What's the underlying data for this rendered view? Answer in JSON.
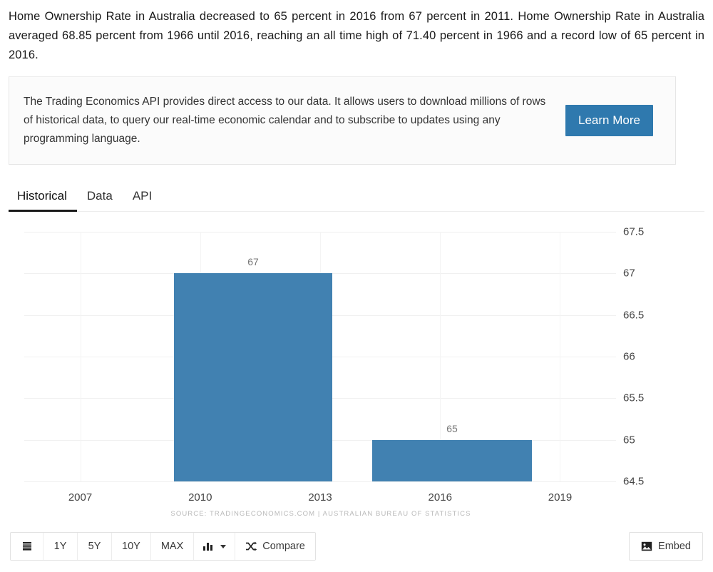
{
  "intro": {
    "paragraph": "Home Ownership Rate in Australia decreased to 65 percent in 2016 from 67 percent in 2011. Home Ownership Rate in Australia averaged 68.85 percent from 1966 until 2016, reaching an all time high of 71.40 percent in 1966 and a record low of 65 percent in 2016."
  },
  "api_panel": {
    "text": "The Trading Economics API provides direct access to our data. It allows users to download millions of rows of historical data, to query our real-time economic calendar and to subscribe to updates using any programming language.",
    "button_label": "Learn More",
    "button_color": "#2f79ae"
  },
  "tabs": [
    {
      "label": "Historical",
      "active": true
    },
    {
      "label": "Data",
      "active": false
    },
    {
      "label": "API",
      "active": false
    }
  ],
  "chart_data": {
    "type": "bar",
    "title": "",
    "xlabel": "",
    "ylabel": "",
    "categories": [
      "2011",
      "2016"
    ],
    "values": [
      67,
      65
    ],
    "bar_labels": [
      "67",
      "65"
    ],
    "bar_color": "#4181b1",
    "x_ticks": [
      "2007",
      "2010",
      "2013",
      "2016",
      "2019"
    ],
    "x_tick_values": [
      2007,
      2010,
      2013,
      2016,
      2019
    ],
    "y_ticks": [
      "67.5",
      "67",
      "66.5",
      "66",
      "65.5",
      "65",
      "64.5"
    ],
    "y_tick_values": [
      67.5,
      67,
      66.5,
      66,
      65.5,
      65,
      64.5
    ],
    "ylim": [
      64.5,
      67.5
    ],
    "xlim": [
      2005.6,
      2020.4
    ],
    "grid": true,
    "legend": "none",
    "y_axis_position": "right",
    "source": "SOURCE: TRADINGECONOMICS.COM  |  AUSTRALIAN BUREAU OF STATISTICS"
  },
  "toolbar": {
    "range_buttons": [
      "1Y",
      "5Y",
      "10Y",
      "MAX"
    ],
    "compare_label": "Compare",
    "embed_label": "Embed"
  }
}
